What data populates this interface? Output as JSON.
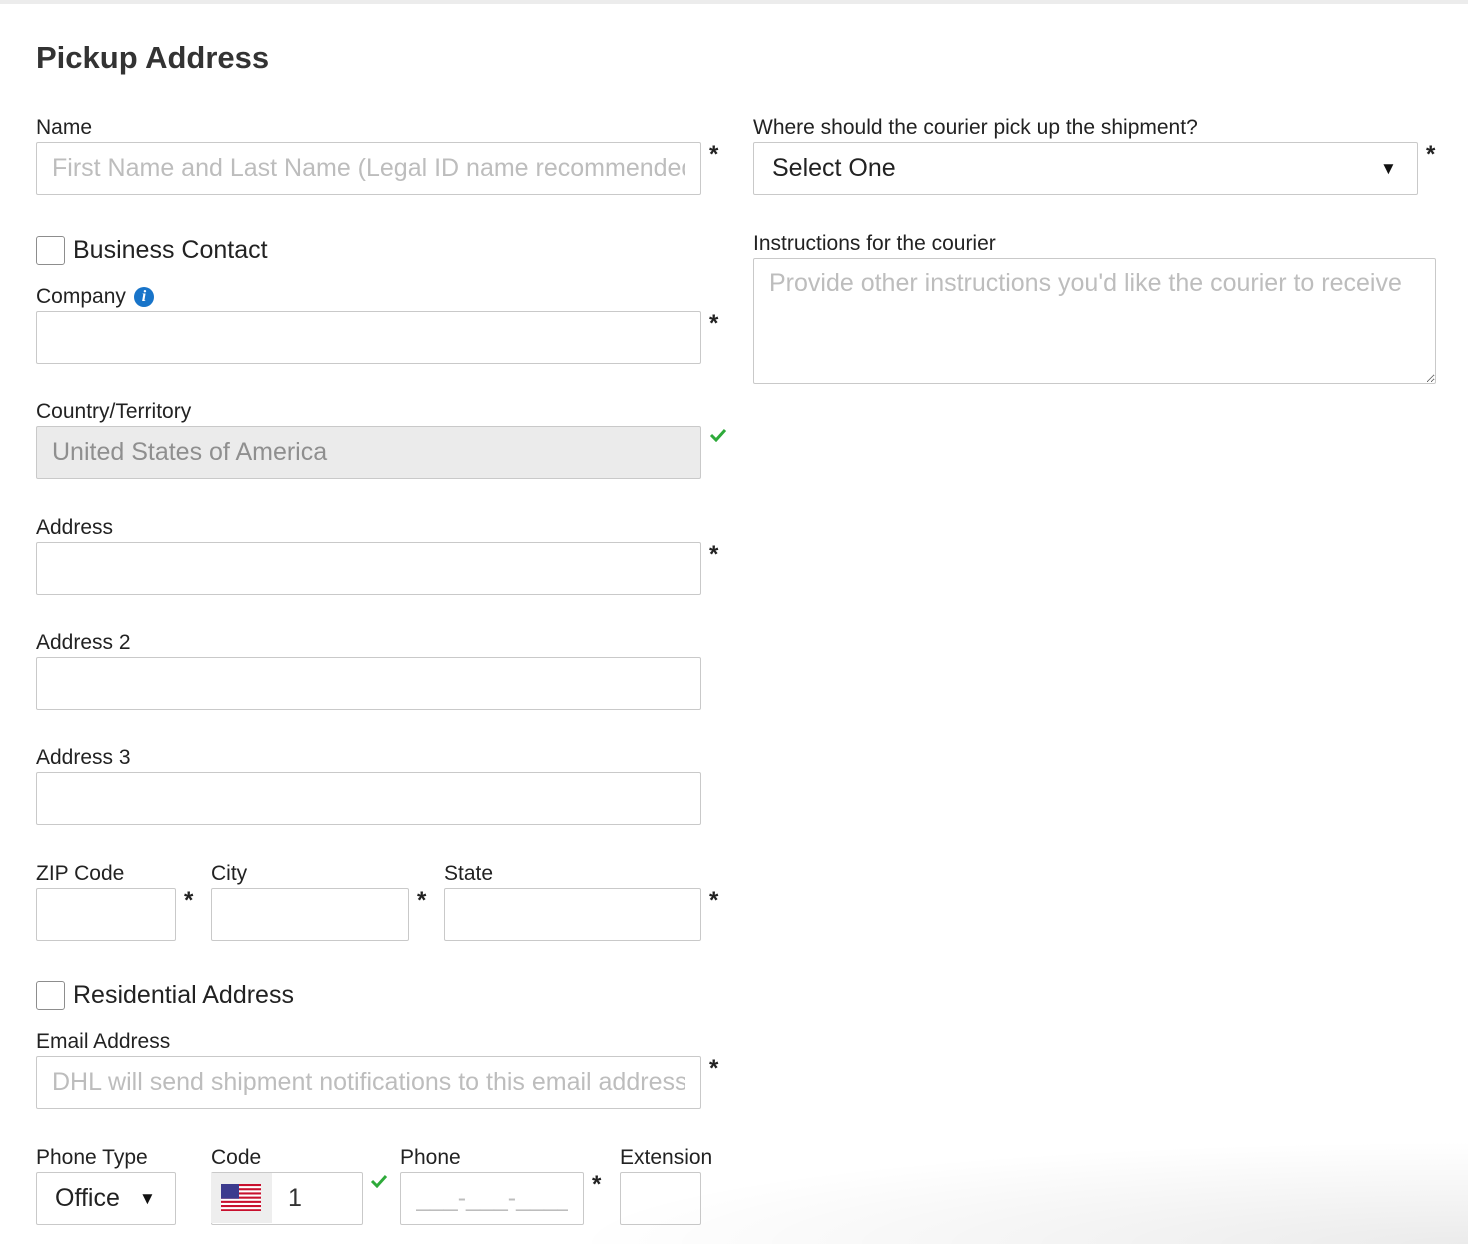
{
  "page": {
    "title": "Pickup Address"
  },
  "name": {
    "label": "Name",
    "placeholder": "First Name and Last Name (Legal ID name recommended)",
    "required": "*"
  },
  "business_contact": {
    "label": "Business Contact",
    "checked": false
  },
  "company": {
    "label": "Company",
    "value": "",
    "required": "*"
  },
  "country": {
    "label": "Country/Territory",
    "value": "United States of America"
  },
  "address": {
    "label": "Address",
    "value": "",
    "required": "*"
  },
  "address2": {
    "label": "Address 2",
    "value": ""
  },
  "address3": {
    "label": "Address 3",
    "value": ""
  },
  "zip": {
    "label": "ZIP Code",
    "value": "",
    "required": "*"
  },
  "city": {
    "label": "City",
    "value": "",
    "required": "*"
  },
  "state": {
    "label": "State",
    "value": "",
    "required": "*"
  },
  "residential": {
    "label": "Residential Address",
    "checked": false
  },
  "email": {
    "label": "Email Address",
    "placeholder": "DHL will send shipment notifications to this email address",
    "required": "*"
  },
  "phone_type": {
    "label": "Phone Type",
    "value": "Office"
  },
  "code": {
    "label": "Code",
    "value": "1",
    "flag": "us-flag-icon"
  },
  "phone": {
    "label": "Phone",
    "placeholder": "___-___-____",
    "required": "*"
  },
  "extension": {
    "label": "Extension",
    "value": ""
  },
  "pickup_location": {
    "label": "Where should the courier pick up the shipment?",
    "value": "Select One",
    "required": "*"
  },
  "instructions": {
    "label": "Instructions for the courier",
    "placeholder": "Provide other instructions you'd like the courier to receive"
  },
  "colors": {
    "valid_check": "#2eaa3a",
    "info_icon": "#1874c9",
    "disabled_bg": "#ebebeb",
    "border": "#c9c9c9",
    "placeholder": "#bdbdbd"
  }
}
